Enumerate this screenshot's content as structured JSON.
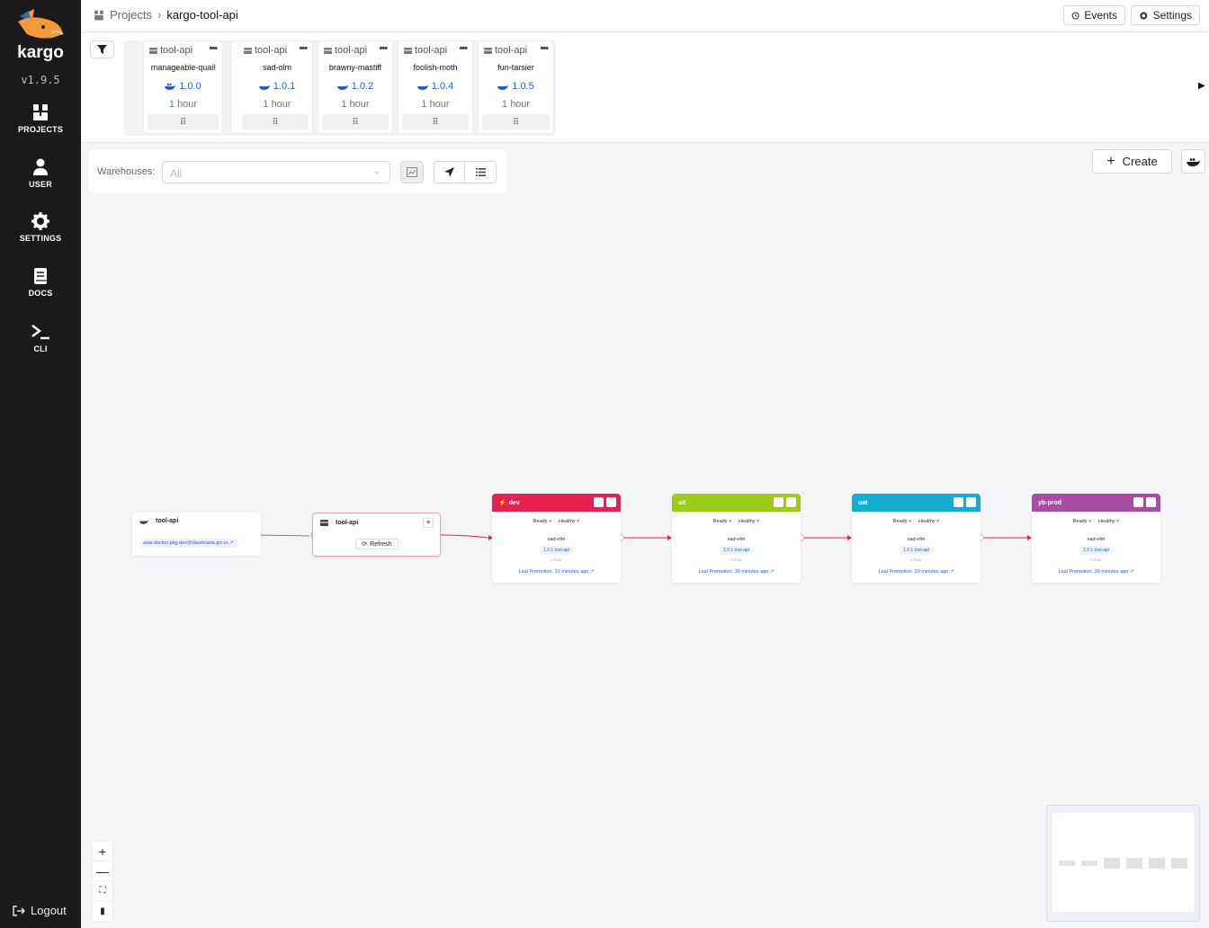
{
  "sidebar": {
    "version": "v1.9.5",
    "nav": [
      {
        "label": "PROJECTS",
        "icon": "projects-icon"
      },
      {
        "label": "USER",
        "icon": "user-icon"
      },
      {
        "label": "SETTINGS",
        "icon": "gear-icon"
      },
      {
        "label": "DOCS",
        "icon": "book-icon"
      },
      {
        "label": "CLI",
        "icon": "terminal-icon"
      }
    ],
    "logout": "Logout"
  },
  "header": {
    "breadcrumb": [
      "Projects",
      "kargo-tool-api"
    ],
    "events_label": "Events",
    "settings_label": "Settings"
  },
  "freight": [
    {
      "warehouse": "tool-api",
      "name": "manageable-quail",
      "tag": "1.0.0",
      "age": "1 hour"
    },
    {
      "warehouse": "tool-api",
      "name": "sad-olm",
      "tag": "1.0.1",
      "age": "1 hour"
    },
    {
      "warehouse": "tool-api",
      "name": "brawny-mastiff",
      "tag": "1.0.2",
      "age": "1 hour"
    },
    {
      "warehouse": "tool-api",
      "name": "foolish-moth",
      "tag": "1.0.4",
      "age": "1 hour"
    },
    {
      "warehouse": "tool-api",
      "name": "fun-tarsier",
      "tag": "1.0.5",
      "age": "1 hour"
    }
  ],
  "stage_colors": [
    "#e8204f",
    "#9ccc1a",
    "#12add1",
    "#a64da3"
  ],
  "toolbar": {
    "warehouses_label": "Warehouses:",
    "warehouses_placeholder": "All",
    "create_label": "Create"
  },
  "graph": {
    "image_node": {
      "name": "tool-api",
      "repo": "asia-docker.pkg.dev/jh9asm/asia.gcr.io"
    },
    "warehouse_node": {
      "name": "tool-api",
      "refresh_label": "Refresh"
    },
    "stages": [
      {
        "name": "dev",
        "color": "#e8204f",
        "ready": "Ready",
        "healthy": "Healthy",
        "freight": "sad-olm",
        "tag": "1.0.1 tool-api",
        "age": "1 hour",
        "last_promotion": "Last Promotion: 31 minutes ago"
      },
      {
        "name": "sit",
        "color": "#9ccc1a",
        "ready": "Ready",
        "healthy": "Healthy",
        "freight": "sad-olm",
        "tag": "1.0.1 tool-api",
        "age": "1 hour",
        "last_promotion": "Last Promotion: 30 minutes ago"
      },
      {
        "name": "uat",
        "color": "#12add1",
        "ready": "Ready",
        "healthy": "Healthy",
        "freight": "sad-olm",
        "tag": "1.0.1 tool-api",
        "age": "1 hour",
        "last_promotion": "Last Promotion: 29 minutes ago"
      },
      {
        "name": "yb-prod",
        "color": "#a64da3",
        "ready": "Ready",
        "healthy": "Healthy",
        "freight": "sad-olm",
        "tag": "1.0.1 tool-api",
        "age": "1 hour",
        "last_promotion": "Last Promotion: 28 minutes ago"
      }
    ]
  },
  "zoom_controls": [
    "+",
    "—",
    "fit",
    "map"
  ]
}
